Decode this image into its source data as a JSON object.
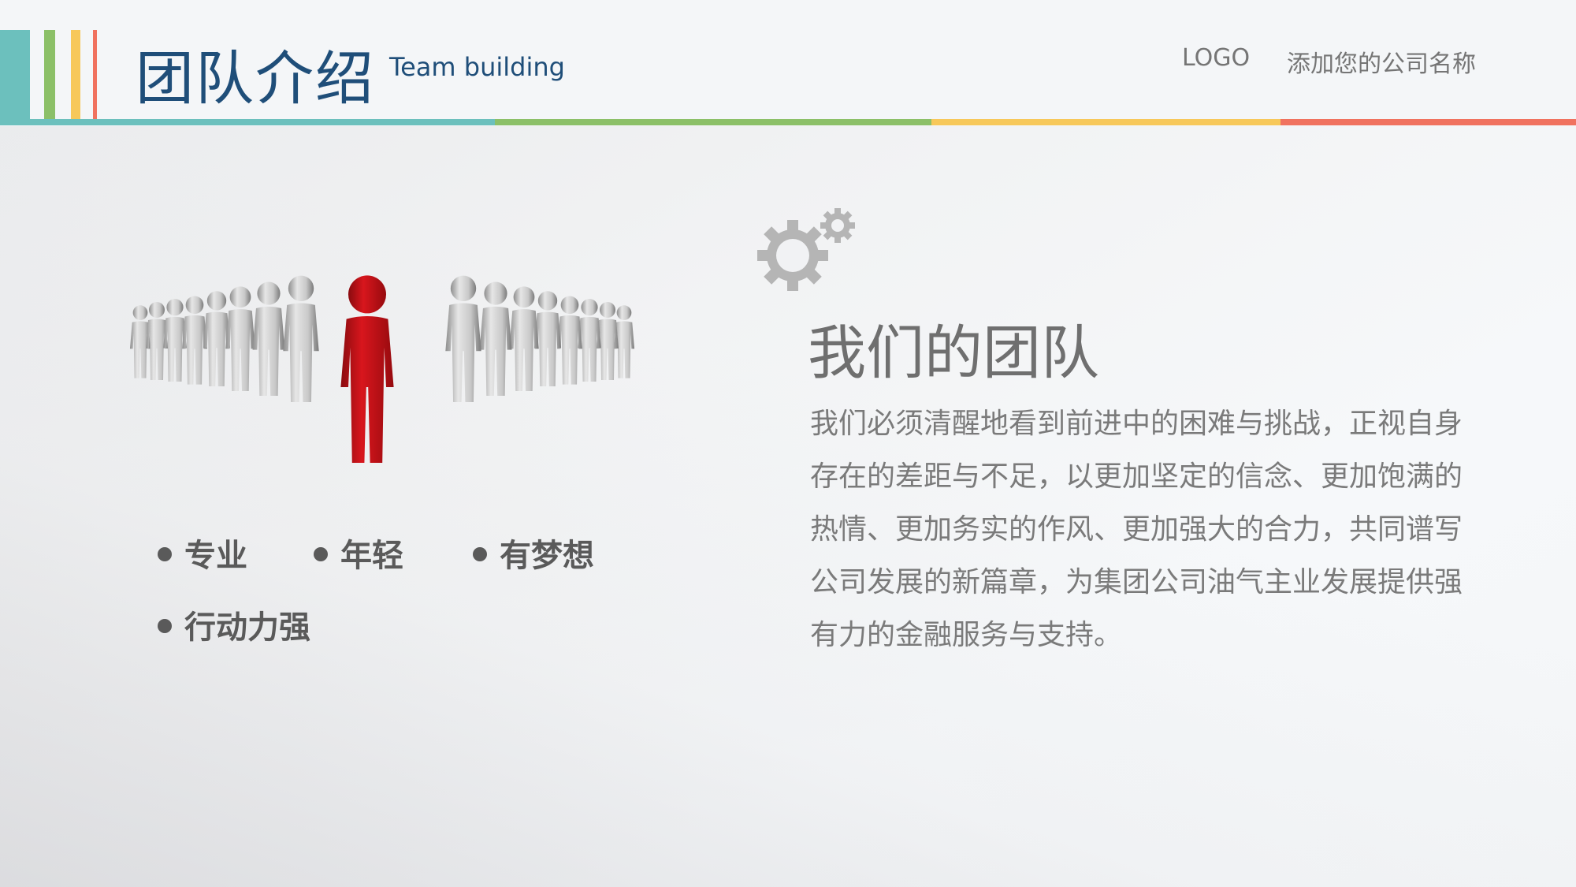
{
  "header": {
    "title": "团队介绍",
    "subtitle": "Team building",
    "logo": "LOGO",
    "company": "添加您的公司名称"
  },
  "colors": {
    "teal": "#6cc0bd",
    "green": "#8cc068",
    "yellow": "#f7c85a",
    "red": "#f0725f",
    "title_blue": "#1f4e79",
    "figure_red": "#c8141a"
  },
  "team_tags": [
    "专业",
    "年轻",
    "有梦想",
    "行动力强"
  ],
  "section": {
    "title": "我们的团队",
    "body": "我们必须清醒地看到前进中的困难与挑战，正视自身存在的差距与不足，以更加坚定的信念、更加饱满的热情、更加务实的作风、更加强大的合力，共同谱写公司发展的新篇章，为集团公司油气主业发展提供强有力的金融服务与支持。"
  },
  "icons": {
    "gears": "gears-icon",
    "team": "team-leader-illustration"
  }
}
